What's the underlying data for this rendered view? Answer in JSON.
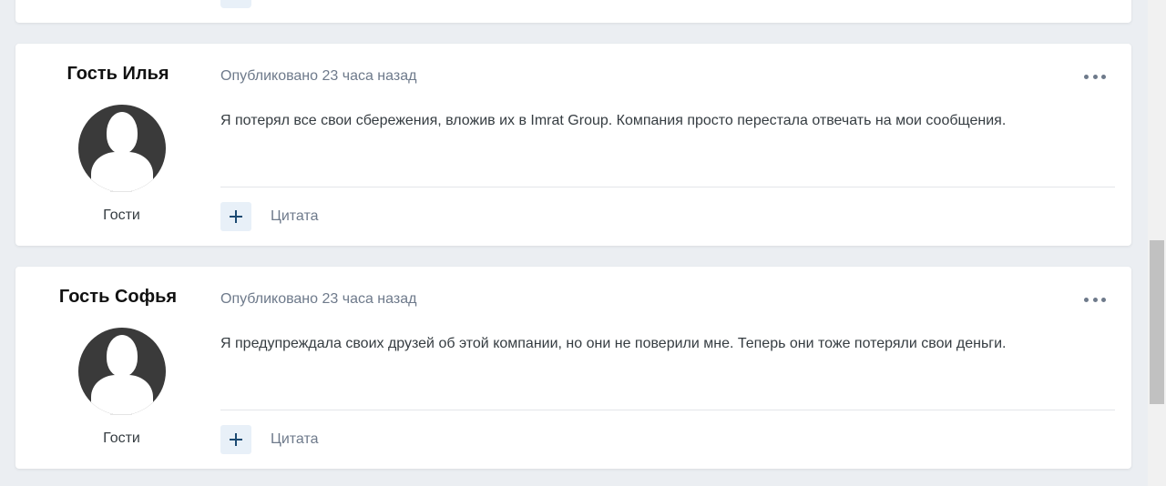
{
  "posts": [
    {
      "author": "Гость Илья",
      "group": "Гости",
      "date": "Опубликовано 23 часа назад",
      "text": "Я потерял все свои сбережения, вложив их в Imrat Group. Компания просто перестала отвечать на мои сообщения.",
      "quote_label": "Цитата"
    },
    {
      "author": "Гость Софья",
      "group": "Гости",
      "date": "Опубликовано 23 часа назад",
      "text": "Я предупреждала своих друзей об этой компании, но они не поверили мне. Теперь они тоже потеряли свои деньги.",
      "quote_label": "Цитата"
    }
  ],
  "icons": {
    "more": "ellipsis-icon",
    "multiquote": "plus-icon",
    "avatar": "default-user-avatar"
  },
  "colors": {
    "page_background": "#ebeef2",
    "meta_text": "#6e7a8b",
    "accent": "#1c4a72"
  }
}
